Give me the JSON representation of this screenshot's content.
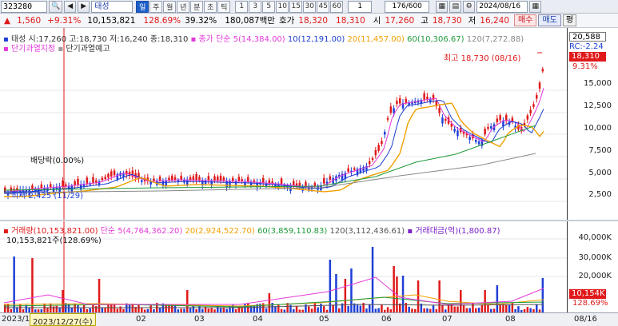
{
  "toolbar": {
    "stock_code": "323280",
    "stock_name": "태성",
    "period_buttons": [
      "일",
      "주",
      "월",
      "년",
      "분",
      "초",
      "틱"
    ],
    "active_period": 0,
    "interval_buttons": [
      "1",
      "3",
      "5",
      "10",
      "15",
      "30",
      "45",
      "60"
    ],
    "interval_value": "1",
    "bar_count": "176/600",
    "date": "2024/08/16"
  },
  "quote": {
    "change_arrow": "▲",
    "change": "1,560",
    "change_pct": "+9.31%",
    "volume": "10,153,821",
    "volume_ratio": "128.69%",
    "turnover": "39.32%",
    "amount": "180,087백만",
    "ask_label": "호가",
    "ask": "18,320",
    "bid": "18,310",
    "open_label": "시",
    "open": "17,260",
    "high_label": "고",
    "high": "18,730",
    "low_label": "저",
    "low": "16,240",
    "buy_label": "매수",
    "sell_label": "매도",
    "eval_label": "평"
  },
  "price_legend": {
    "summary": "태성 시:17,260 고:18,730 저:16,240 종:18,310",
    "ma5": "종가 단순 5(14,384.00)",
    "ma10": "10(12,191.00)",
    "ma20": "20(11,457.00)",
    "ma60": "60(10,306.67)",
    "ma120": "120(7,272.88)",
    "flag1": "단기과열지정",
    "flag2": "단기과열예고"
  },
  "annotations": {
    "high_note": "최고 18,730 (08/16)",
    "low_note": "최저 2,425 (11/29)",
    "dividend_note": "배당락(0.00%)",
    "cursor_date": "2023/12/27(수)"
  },
  "price_axis": {
    "top_badge": "20,588",
    "rc_label": "RC:-2.24",
    "last_price": "18,310",
    "last_pct": "9.31%",
    "ticks": [
      "15,000",
      "12,500",
      "10,000",
      "7,500",
      "5,000",
      "2,500"
    ]
  },
  "volume_legend": {
    "volume": "거래량(10,153,821.00)",
    "ma5": "단순 5(4,764,362.20)",
    "ma20": "20(2,924,522.70)",
    "ma60": "60(3,859,110.83)",
    "ma120": "120(3,112,436.61)",
    "amount": "거래대금(억)(1,800.87)",
    "last_volume": "10,153,821주(128.69%)"
  },
  "volume_axis": {
    "ticks": [
      "40,000K",
      "30,000K",
      "20,000K"
    ],
    "last_value": "10,154K",
    "last_pct": "128.69%"
  },
  "date_axis": {
    "labels": [
      "2023/11",
      "02",
      "03",
      "04",
      "05",
      "06",
      "07",
      "08",
      "08/16"
    ]
  },
  "colors": {
    "up": "#e0191a",
    "down": "#1f3fd6",
    "ma5": "#e23ad8",
    "ma10": "#1b3ed0",
    "ma20": "#f0a000",
    "ma60": "#1f9a3a",
    "ma120": "#888888",
    "vol_ma5": "#e23ad8",
    "vol_ma20": "#f0a000",
    "vol_ma60": "#1f9a3a",
    "vol_ma120": "#555555",
    "amount": "#7a1fc6"
  }
}
